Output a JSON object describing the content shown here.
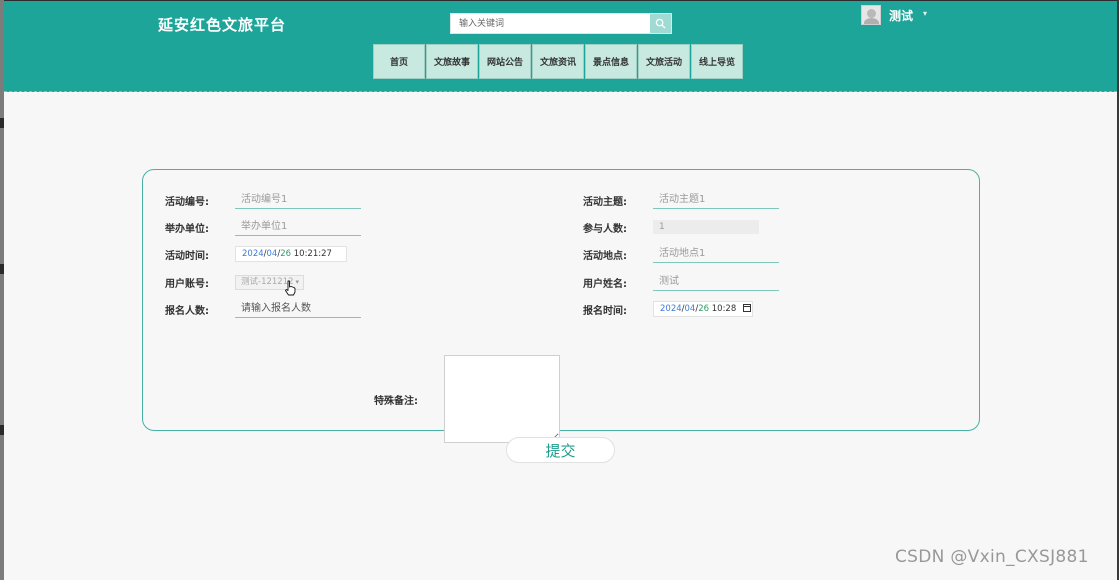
{
  "app": {
    "brand": "延安红色文旅平台"
  },
  "search": {
    "placeholder": "输入关键词"
  },
  "user": {
    "name": "测试"
  },
  "nav": {
    "items": [
      {
        "label": "首页"
      },
      {
        "label": "文旅故事"
      },
      {
        "label": "网站公告"
      },
      {
        "label": "文旅资讯"
      },
      {
        "label": "景点信息"
      },
      {
        "label": "文旅活动"
      },
      {
        "label": "线上导览"
      }
    ]
  },
  "form": {
    "activity_no": {
      "label": "活动编号:",
      "value": "活动编号1"
    },
    "activity_theme": {
      "label": "活动主题:",
      "value": "活动主题1"
    },
    "organizer": {
      "label": "举办单位:",
      "value": "举办单位1"
    },
    "participants": {
      "label": "参与人数:",
      "value": "1"
    },
    "activity_time": {
      "label": "活动时间:",
      "year": "2024",
      "month": "04",
      "day": "26",
      "time": "10:21:27"
    },
    "activity_place": {
      "label": "活动地点:",
      "value": "活动地点1"
    },
    "user_account": {
      "label": "用户账号:",
      "value": "测试-121212"
    },
    "user_name": {
      "label": "用户姓名:",
      "value": "测试"
    },
    "signup_count": {
      "label": "报名人数:",
      "placeholder": "请输入报名人数"
    },
    "signup_time": {
      "label": "报名时间:",
      "year": "2024",
      "month": "04",
      "day": "26",
      "time": "10:28"
    },
    "remarks": {
      "label": "特殊备注:"
    }
  },
  "submit": {
    "label": "提交"
  },
  "watermark": "CSDN @Vxin_CXSJ881",
  "colors": {
    "primary": "#1da59a",
    "nav_bg": "#c8e9e0",
    "panel_border": "#49b0a4"
  }
}
